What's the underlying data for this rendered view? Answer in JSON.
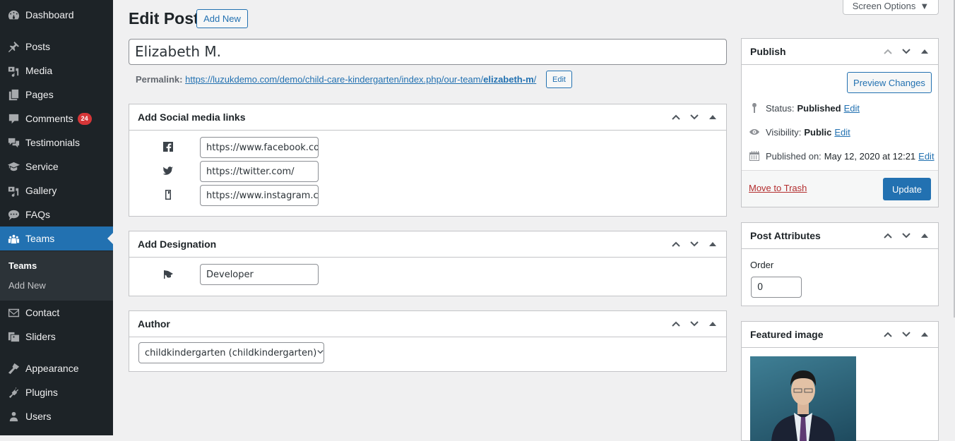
{
  "sidebar": {
    "items": [
      {
        "label": "Dashboard",
        "icon": "dashboard-icon"
      },
      {
        "label": "Posts",
        "icon": "pin-icon"
      },
      {
        "label": "Media",
        "icon": "media-icon"
      },
      {
        "label": "Pages",
        "icon": "pages-icon"
      },
      {
        "label": "Comments",
        "icon": "comment-icon",
        "badge": "24"
      },
      {
        "label": "Testimonials",
        "icon": "testimonials-icon"
      },
      {
        "label": "Service",
        "icon": "graduation-cap-icon"
      },
      {
        "label": "Gallery",
        "icon": "gallery-icon"
      },
      {
        "label": "FAQs",
        "icon": "faq-icon"
      },
      {
        "label": "Teams",
        "icon": "groups-icon",
        "active": true
      },
      {
        "label": "Contact",
        "icon": "email-icon"
      },
      {
        "label": "Sliders",
        "icon": "slides-icon"
      },
      {
        "label": "Appearance",
        "icon": "paintbrush-icon"
      },
      {
        "label": "Plugins",
        "icon": "plugin-icon"
      },
      {
        "label": "Users",
        "icon": "user-icon"
      }
    ],
    "submenu": [
      {
        "label": "Teams",
        "current": true
      },
      {
        "label": "Add New"
      }
    ]
  },
  "header": {
    "title": "Edit Post",
    "add_new": "Add New",
    "screen_options": "Screen Options"
  },
  "post": {
    "title": "Elizabeth M.",
    "permalink_label": "Permalink:",
    "permalink_base": "https://luzukdemo.com/demo/child-care-kindergarten/index.php/our-team/",
    "permalink_slug": "elizabeth-m",
    "permalink_end": "/",
    "permalink_edit": "Edit"
  },
  "social": {
    "title": "Add Social media links",
    "links": [
      {
        "icon": "facebook-icon",
        "value": "https://www.facebook.com/"
      },
      {
        "icon": "twitter-icon",
        "value": "https://twitter.com/"
      },
      {
        "icon": "instagram-icon",
        "value": "https://www.instagram.com/"
      }
    ]
  },
  "designation": {
    "title": "Add Designation",
    "value": "Developer"
  },
  "author": {
    "title": "Author",
    "selected": "childkindergarten (childkindergarten)"
  },
  "publish": {
    "title": "Publish",
    "preview": "Preview Changes",
    "status_label": "Status:",
    "status_value": "Published",
    "visibility_label": "Visibility:",
    "visibility_value": "Public",
    "published_label": "Published on:",
    "published_value": "May 12, 2020 at 12:21",
    "edit": "Edit",
    "trash": "Move to Trash",
    "update": "Update",
    "colors": {
      "primary": "#2271b1",
      "trash": "#b32d2e"
    }
  },
  "attributes": {
    "title": "Post Attributes",
    "order_label": "Order",
    "order_value": "0"
  },
  "featured": {
    "title": "Featured image"
  }
}
